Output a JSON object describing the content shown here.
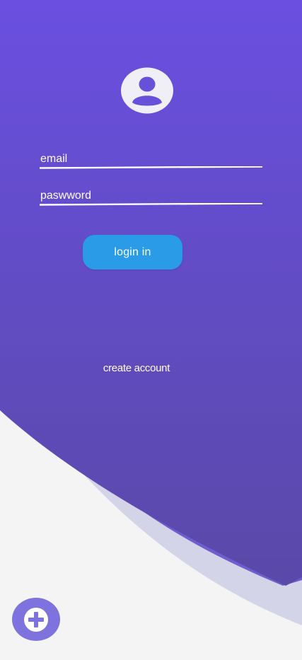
{
  "login_form": {
    "email_placeholder": "email",
    "password_placeholder": "paswword",
    "login_button_label": "login in",
    "create_account_label": "create account"
  },
  "icons": {
    "avatar": "user-avatar-icon",
    "fab": "plus-circle-icon"
  },
  "colors": {
    "gradient_top": "#6a4fe0",
    "gradient_bottom": "#5a49a8",
    "back_wave": "#d4d4e8",
    "side_wave": "#6e5ed0",
    "login_button": "#2a9be6",
    "fab": "#7d72de",
    "background": "#f4f4f4",
    "avatar_fill": "#f0eff5"
  }
}
